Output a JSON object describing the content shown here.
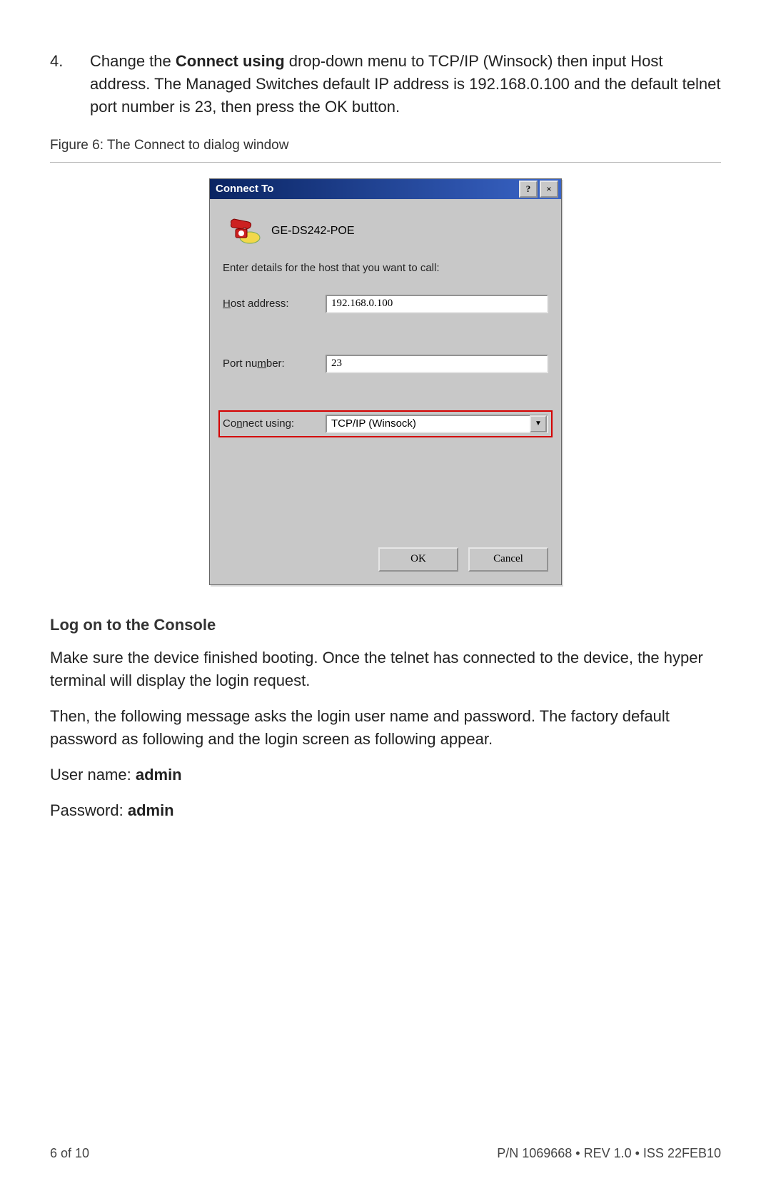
{
  "step": {
    "number": "4.",
    "text_before": "Change the ",
    "bold1": "Connect using",
    "text_after": " drop-down menu to TCP/IP (Winsock) then input Host address. The Managed Switches default IP address is 192.168.0.100 and the default telnet port number is 23, then press the OK button."
  },
  "figure_caption": "Figure 6: The Connect to dialog window",
  "dialog": {
    "title": "Connect To",
    "titlebar": {
      "help": "?",
      "close": "×"
    },
    "connection_name": "GE-DS242-POE",
    "prompt": "Enter details for the host that you want to call:",
    "fields": {
      "host": {
        "label_pre": "H",
        "label_post": "ost address:",
        "value": "192.168.0.100"
      },
      "port": {
        "label_pre_plain": "Port nu",
        "label_ul": "m",
        "label_post": "ber:",
        "value": "23"
      },
      "connect": {
        "label_pre_plain": "Co",
        "label_ul": "n",
        "label_post": "nect using:",
        "value": "TCP/IP (Winsock)",
        "arrow": "▼"
      }
    },
    "buttons": {
      "ok": "OK",
      "cancel": "Cancel"
    }
  },
  "section_heading": "Log on to the Console",
  "para1": "Make sure the device finished booting. Once the telnet has connected to the device, the hyper terminal will display the login request.",
  "para2": "Then, the following message asks the login user name and password. The factory default password as following and the login screen as following appear.",
  "creds": {
    "user_label": "User name: ",
    "user_value": "admin",
    "pass_label": "Password: ",
    "pass_value": "admin"
  },
  "footer": {
    "left": "6 of 10",
    "right": "P/N 1069668 • REV 1.0 • ISS 22FEB10"
  }
}
